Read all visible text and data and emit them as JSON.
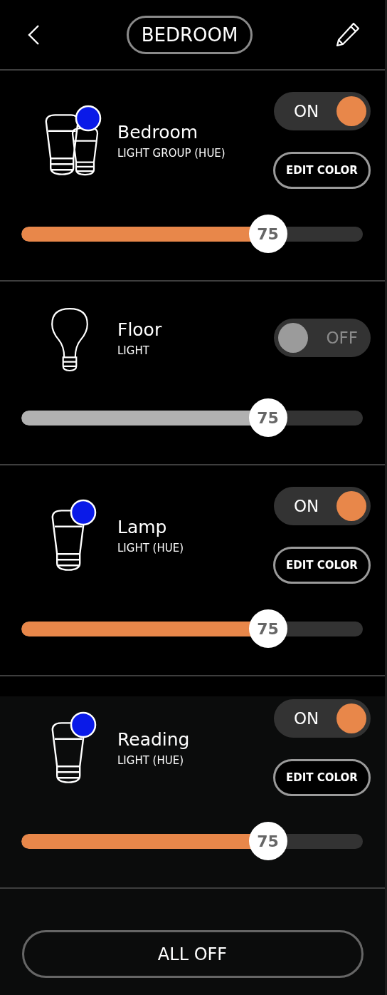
{
  "header": {
    "title": "BEDROOM"
  },
  "devices": [
    {
      "name": "Bedroom",
      "type": "LIGHT GROUP (HUE)",
      "kind": "group",
      "color": "#0a1ae8",
      "on": true,
      "toggle_label": "ON",
      "edit_label": "EDIT COLOR",
      "level": 0.75,
      "reading": "75",
      "selected": false
    },
    {
      "name": "Floor",
      "type": "LIGHT",
      "kind": "plain",
      "on": false,
      "toggle_label": "OFF",
      "level": 0.75,
      "reading": "75",
      "selected": false
    },
    {
      "name": "Lamp",
      "type": "LIGHT (HUE)",
      "kind": "single",
      "color": "#0a1ae8",
      "on": true,
      "toggle_label": "ON",
      "edit_label": "EDIT COLOR",
      "level": 0.75,
      "reading": "75",
      "selected": false
    },
    {
      "name": "Reading",
      "type": "LIGHT (HUE)",
      "kind": "single",
      "color": "#0a1ae8",
      "on": true,
      "toggle_label": "ON",
      "edit_label": "EDIT COLOR",
      "level": 0.75,
      "reading": "75",
      "selected": true
    }
  ],
  "footer": {
    "button": "ALL OFF"
  }
}
